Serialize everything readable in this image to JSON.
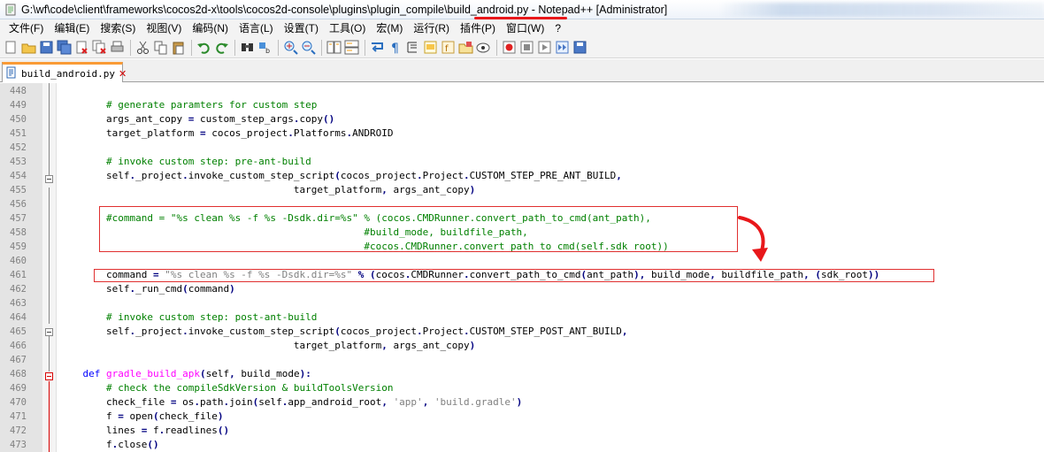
{
  "window": {
    "title": "G:\\wf\\code\\client\\frameworks\\cocos2d-x\\tools\\cocos2d-console\\plugins\\plugin_compile\\build_android.py - Notepad++ [Administrator]"
  },
  "menu": [
    {
      "label": "文件(F)"
    },
    {
      "label": "编辑(E)"
    },
    {
      "label": "搜索(S)"
    },
    {
      "label": "视图(V)"
    },
    {
      "label": "编码(N)"
    },
    {
      "label": "语言(L)"
    },
    {
      "label": "设置(T)"
    },
    {
      "label": "工具(O)"
    },
    {
      "label": "宏(M)"
    },
    {
      "label": "运行(R)"
    },
    {
      "label": "插件(P)"
    },
    {
      "label": "窗口(W)"
    },
    {
      "label": "?"
    }
  ],
  "toolbar_icons": [
    "new-file-icon",
    "open-file-icon",
    "save-icon",
    "save-all-icon",
    "close-icon",
    "close-all-icon",
    "print-icon",
    "sep",
    "cut-icon",
    "copy-icon",
    "paste-icon",
    "sep",
    "undo-icon",
    "redo-icon",
    "sep",
    "find-icon",
    "replace-icon",
    "sep",
    "zoom-in-icon",
    "zoom-out-icon",
    "sep",
    "sync-vertical-icon",
    "sync-horizontal-icon",
    "sep",
    "word-wrap-icon",
    "show-all-chars-icon",
    "indent-guide-icon",
    "doc-map-icon",
    "function-list-icon",
    "folder-workspace-icon",
    "monitor-icon",
    "sep",
    "record-macro-icon",
    "stop-macro-icon",
    "play-macro-icon",
    "run-macro-multiple-icon",
    "save-macro-icon"
  ],
  "tab": {
    "label": "build_android.py"
  },
  "lines": [
    {
      "no": "448",
      "tokens": []
    },
    {
      "no": "449",
      "tokens": [
        {
          "t": "        "
        },
        {
          "t": "# generate paramters for custom step",
          "c": "cm"
        }
      ]
    },
    {
      "no": "450",
      "tokens": [
        {
          "t": "        args_ant_copy "
        },
        {
          "t": "=",
          "c": "op"
        },
        {
          "t": " custom_step_args"
        },
        {
          "t": ".",
          "c": "op"
        },
        {
          "t": "copy"
        },
        {
          "t": "()",
          "c": "op"
        }
      ]
    },
    {
      "no": "451",
      "tokens": [
        {
          "t": "        target_platform "
        },
        {
          "t": "=",
          "c": "op"
        },
        {
          "t": " cocos_project"
        },
        {
          "t": ".",
          "c": "op"
        },
        {
          "t": "Platforms"
        },
        {
          "t": ".",
          "c": "op"
        },
        {
          "t": "ANDROID"
        }
      ]
    },
    {
      "no": "452",
      "tokens": []
    },
    {
      "no": "453",
      "tokens": [
        {
          "t": "        "
        },
        {
          "t": "# invoke custom step: pre-ant-build",
          "c": "cm"
        }
      ]
    },
    {
      "no": "454",
      "tokens": [
        {
          "t": "        self"
        },
        {
          "t": ".",
          "c": "op"
        },
        {
          "t": "_project"
        },
        {
          "t": ".",
          "c": "op"
        },
        {
          "t": "invoke_custom_step_script"
        },
        {
          "t": "(",
          "c": "op"
        },
        {
          "t": "cocos_project"
        },
        {
          "t": ".",
          "c": "op"
        },
        {
          "t": "Project"
        },
        {
          "t": ".",
          "c": "op"
        },
        {
          "t": "CUSTOM_STEP_PRE_ANT_BUILD"
        },
        {
          "t": ",",
          "c": "op"
        }
      ]
    },
    {
      "no": "455",
      "tokens": [
        {
          "t": "                                        target_platform"
        },
        {
          "t": ",",
          "c": "op"
        },
        {
          "t": " args_ant_copy"
        },
        {
          "t": ")",
          "c": "op"
        }
      ]
    },
    {
      "no": "456",
      "tokens": []
    },
    {
      "no": "457",
      "tokens": [
        {
          "t": "        "
        },
        {
          "t": "#command = \"%s clean %s -f %s -Dsdk.dir=%s\" % (cocos.CMDRunner.convert_path_to_cmd(ant_path),",
          "c": "cm"
        }
      ]
    },
    {
      "no": "458",
      "tokens": [
        {
          "t": "                                                    "
        },
        {
          "t": "#build_mode, buildfile_path,",
          "c": "cm"
        }
      ]
    },
    {
      "no": "459",
      "tokens": [
        {
          "t": "                                                    "
        },
        {
          "t": "#cocos.CMDRunner.convert_path_to_cmd(self.sdk_root))",
          "c": "cm"
        }
      ]
    },
    {
      "no": "460",
      "tokens": []
    },
    {
      "no": "461",
      "tokens": [
        {
          "t": "        command "
        },
        {
          "t": "=",
          "c": "op"
        },
        {
          "t": " "
        },
        {
          "t": "\"%s clean %s -f %s -Dsdk.dir=%s\"",
          "c": "st"
        },
        {
          "t": " "
        },
        {
          "t": "%",
          "c": "op"
        },
        {
          "t": " "
        },
        {
          "t": "(",
          "c": "op"
        },
        {
          "t": "cocos"
        },
        {
          "t": ".",
          "c": "op"
        },
        {
          "t": "CMDRunner"
        },
        {
          "t": ".",
          "c": "op"
        },
        {
          "t": "convert_path_to_cmd"
        },
        {
          "t": "(",
          "c": "op"
        },
        {
          "t": "ant_path"
        },
        {
          "t": "),",
          "c": "op"
        },
        {
          "t": " build_mode"
        },
        {
          "t": ",",
          "c": "op"
        },
        {
          "t": " buildfile_path"
        },
        {
          "t": ",",
          "c": "op"
        },
        {
          "t": " "
        },
        {
          "t": "(",
          "c": "op"
        },
        {
          "t": "sdk_root"
        },
        {
          "t": "))",
          "c": "op"
        }
      ]
    },
    {
      "no": "462",
      "tokens": [
        {
          "t": "        self"
        },
        {
          "t": ".",
          "c": "op"
        },
        {
          "t": "_run_cmd"
        },
        {
          "t": "(",
          "c": "op"
        },
        {
          "t": "command"
        },
        {
          "t": ")",
          "c": "op"
        }
      ]
    },
    {
      "no": "463",
      "tokens": []
    },
    {
      "no": "464",
      "tokens": [
        {
          "t": "        "
        },
        {
          "t": "# invoke custom step: post-ant-build",
          "c": "cm"
        }
      ]
    },
    {
      "no": "465",
      "tokens": [
        {
          "t": "        self"
        },
        {
          "t": ".",
          "c": "op"
        },
        {
          "t": "_project"
        },
        {
          "t": ".",
          "c": "op"
        },
        {
          "t": "invoke_custom_step_script"
        },
        {
          "t": "(",
          "c": "op"
        },
        {
          "t": "cocos_project"
        },
        {
          "t": ".",
          "c": "op"
        },
        {
          "t": "Project"
        },
        {
          "t": ".",
          "c": "op"
        },
        {
          "t": "CUSTOM_STEP_POST_ANT_BUILD"
        },
        {
          "t": ",",
          "c": "op"
        }
      ]
    },
    {
      "no": "466",
      "tokens": [
        {
          "t": "                                        target_platform"
        },
        {
          "t": ",",
          "c": "op"
        },
        {
          "t": " args_ant_copy"
        },
        {
          "t": ")",
          "c": "op"
        }
      ]
    },
    {
      "no": "467",
      "tokens": []
    },
    {
      "no": "468",
      "tokens": [
        {
          "t": "    "
        },
        {
          "t": "def",
          "c": "kw"
        },
        {
          "t": " "
        },
        {
          "t": "gradle_build_apk",
          "c": "fn"
        },
        {
          "t": "(",
          "c": "op"
        },
        {
          "t": "self"
        },
        {
          "t": ",",
          "c": "op"
        },
        {
          "t": " build_mode"
        },
        {
          "t": "):",
          "c": "op"
        }
      ]
    },
    {
      "no": "469",
      "tokens": [
        {
          "t": "        "
        },
        {
          "t": "# check the compileSdkVersion & buildToolsVersion",
          "c": "cm"
        }
      ]
    },
    {
      "no": "470",
      "tokens": [
        {
          "t": "        check_file "
        },
        {
          "t": "=",
          "c": "op"
        },
        {
          "t": " os"
        },
        {
          "t": ".",
          "c": "op"
        },
        {
          "t": "path"
        },
        {
          "t": ".",
          "c": "op"
        },
        {
          "t": "join"
        },
        {
          "t": "(",
          "c": "op"
        },
        {
          "t": "self"
        },
        {
          "t": ".",
          "c": "op"
        },
        {
          "t": "app_android_root"
        },
        {
          "t": ",",
          "c": "op"
        },
        {
          "t": " "
        },
        {
          "t": "'app'",
          "c": "st"
        },
        {
          "t": ",",
          "c": "op"
        },
        {
          "t": " "
        },
        {
          "t": "'build.gradle'",
          "c": "st"
        },
        {
          "t": ")",
          "c": "op"
        }
      ]
    },
    {
      "no": "471",
      "tokens": [
        {
          "t": "        f "
        },
        {
          "t": "=",
          "c": "op"
        },
        {
          "t": " open"
        },
        {
          "t": "(",
          "c": "op"
        },
        {
          "t": "check_file"
        },
        {
          "t": ")",
          "c": "op"
        }
      ]
    },
    {
      "no": "472",
      "tokens": [
        {
          "t": "        lines "
        },
        {
          "t": "=",
          "c": "op"
        },
        {
          "t": " f"
        },
        {
          "t": ".",
          "c": "op"
        },
        {
          "t": "readlines"
        },
        {
          "t": "()",
          "c": "op"
        }
      ]
    },
    {
      "no": "473",
      "tokens": [
        {
          "t": "        f"
        },
        {
          "t": ".",
          "c": "op"
        },
        {
          "t": "close"
        },
        {
          "t": "()",
          "c": "op"
        }
      ]
    }
  ],
  "colors": {
    "comment": "#008000",
    "string": "#808080",
    "keyword": "#0000ff",
    "function_name": "#ff00ff",
    "operator": "#000080",
    "annotation_red": "#e03030",
    "tab_accent": "#fa9b36"
  }
}
